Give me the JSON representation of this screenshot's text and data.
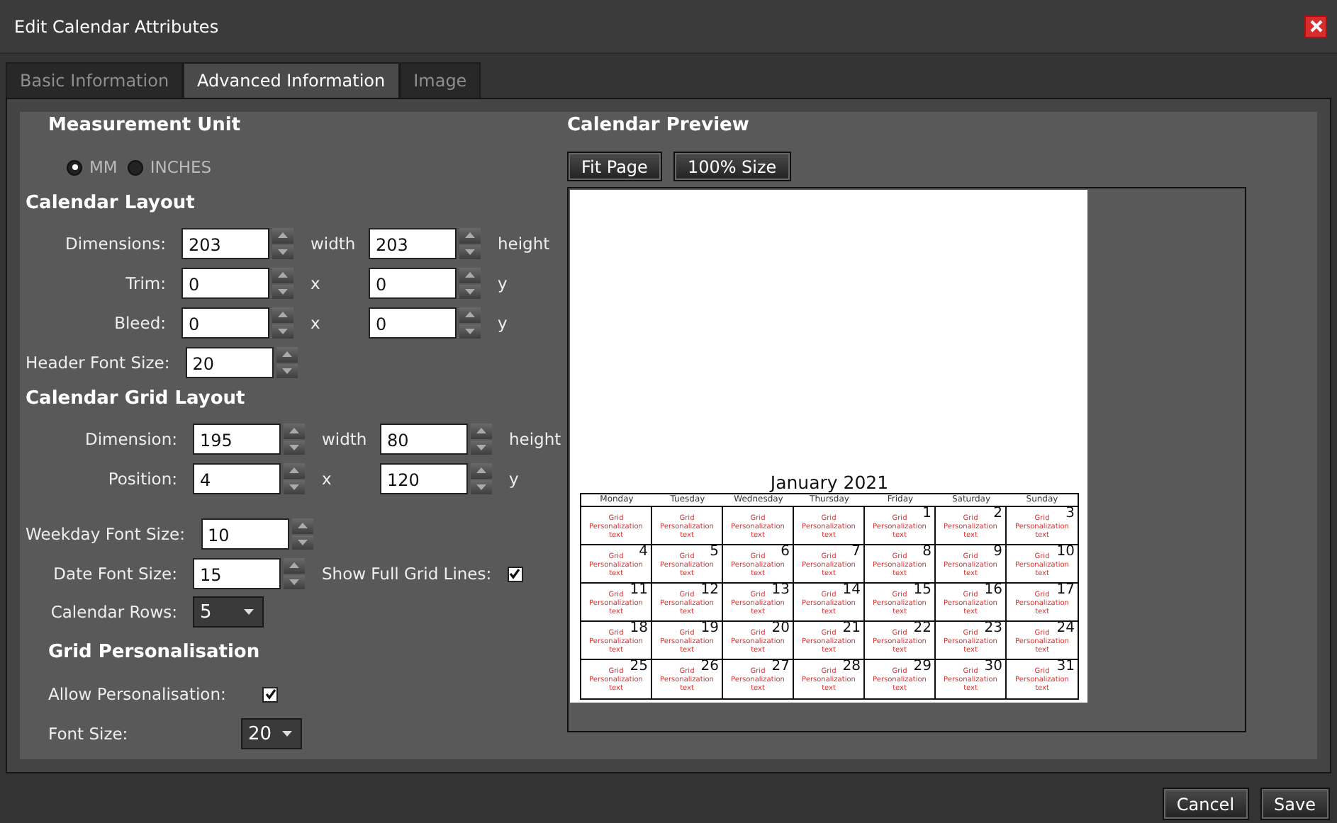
{
  "window": {
    "title": "Edit Calendar Attributes"
  },
  "tabs": [
    {
      "label": "Basic Information",
      "selected": false
    },
    {
      "label": "Advanced Information",
      "selected": true
    },
    {
      "label": "Image",
      "selected": false
    }
  ],
  "measurement_unit": {
    "title": "Measurement Unit",
    "options": [
      {
        "label": "MM",
        "selected": true
      },
      {
        "label": "INCHES",
        "selected": false
      }
    ]
  },
  "calendar_layout": {
    "title": "Calendar Layout",
    "rows": [
      {
        "label": "Dimensions:",
        "value_1": "203",
        "unit_1": "width",
        "value_2": "203",
        "unit_2": "height"
      },
      {
        "label": "Trim:",
        "value_1": "0",
        "unit_1": "x",
        "value_2": "0",
        "unit_2": "y"
      },
      {
        "label": "Bleed:",
        "value_1": "0",
        "unit_1": "x",
        "value_2": "0",
        "unit_2": "y"
      },
      {
        "label": "Header Font Size:",
        "value_1": "20"
      }
    ]
  },
  "calendar_grid_layout": {
    "title": "Calendar Grid Layout",
    "rows": [
      {
        "label": "Dimension:",
        "value_1": "195",
        "unit_1": "width",
        "value_2": "80",
        "unit_2": "height"
      },
      {
        "label": "Position:",
        "value_1": "4",
        "unit_1": "x",
        "value_2": "120",
        "unit_2": "y"
      }
    ]
  },
  "font_settings": [
    {
      "kind": "spinner",
      "label": "Weekday Font Size:",
      "value": "10"
    },
    {
      "kind": "spinner",
      "label": "Date Font Size:",
      "value": "15"
    },
    {
      "kind": "dropdown",
      "label": "Calendar Rows:",
      "value": "5"
    }
  ],
  "show_full_grid_lines": {
    "label": "Show Full Grid Lines:",
    "checked": true
  },
  "grid_personalisation": {
    "title": "Grid Personalisation",
    "allow": {
      "label": "Allow Personalisation:",
      "checked": true
    },
    "font_size": {
      "label": "Font Size:",
      "value": "20"
    }
  },
  "preview": {
    "title": "Calendar Preview",
    "buttons": [
      "Fit Page",
      "100% Size"
    ],
    "calendar": {
      "title": "January 2021",
      "weekdays": [
        "Monday",
        "Tuesday",
        "Wednesday",
        "Thursday",
        "Friday",
        "Saturday",
        "Sunday"
      ],
      "weeks": [
        [
          {
            "text": "Grid Personalization text"
          },
          {
            "text": "Grid Personalization text"
          },
          {
            "text": "Grid Personalization text"
          },
          {
            "text": "Grid Personalization text"
          },
          {
            "date": "1",
            "text": "Grid Personalization text"
          },
          {
            "date": "2",
            "text": "Grid Personalization text"
          },
          {
            "date": "3",
            "text": "Grid Personalization text"
          }
        ],
        [
          {
            "date": "4",
            "text": "Grid Personalization text"
          },
          {
            "date": "5",
            "text": "Grid Personalization text"
          },
          {
            "date": "6",
            "text": "Grid Personalization text"
          },
          {
            "date": "7",
            "text": "Grid Personalization text"
          },
          {
            "date": "8",
            "text": "Grid Personalization text"
          },
          {
            "date": "9",
            "text": "Grid Personalization text"
          },
          {
            "date": "10",
            "text": "Grid Personalization text"
          }
        ],
        [
          {
            "date": "11",
            "text": "Grid Personalization text"
          },
          {
            "date": "12",
            "text": "Grid Personalization text"
          },
          {
            "date": "13",
            "text": "Grid Personalization text"
          },
          {
            "date": "14",
            "text": "Grid Personalization text"
          },
          {
            "date": "15",
            "text": "Grid Personalization text"
          },
          {
            "date": "16",
            "text": "Grid Personalization text"
          },
          {
            "date": "17",
            "text": "Grid Personalization text"
          }
        ],
        [
          {
            "date": "18",
            "text": "Grid Personalization text"
          },
          {
            "date": "19",
            "text": "Grid Personalization text"
          },
          {
            "date": "20",
            "text": "Grid Personalization text"
          },
          {
            "date": "21",
            "text": "Grid Personalization text"
          },
          {
            "date": "22",
            "text": "Grid Personalization text"
          },
          {
            "date": "23",
            "text": "Grid Personalization text"
          },
          {
            "date": "24",
            "text": "Grid Personalization text"
          }
        ],
        [
          {
            "date": "25",
            "text": "Grid Personalization text"
          },
          {
            "date": "26",
            "text": "Grid Personalization text"
          },
          {
            "date": "27",
            "text": "Grid Personalization text"
          },
          {
            "date": "28",
            "text": "Grid Personalization text"
          },
          {
            "date": "29",
            "text": "Grid Personalization text"
          },
          {
            "date": "30",
            "text": "Grid Personalization text"
          },
          {
            "date": "31",
            "text": "Grid Personalization text"
          }
        ]
      ]
    }
  },
  "buttons": [
    "Cancel",
    "Save"
  ]
}
